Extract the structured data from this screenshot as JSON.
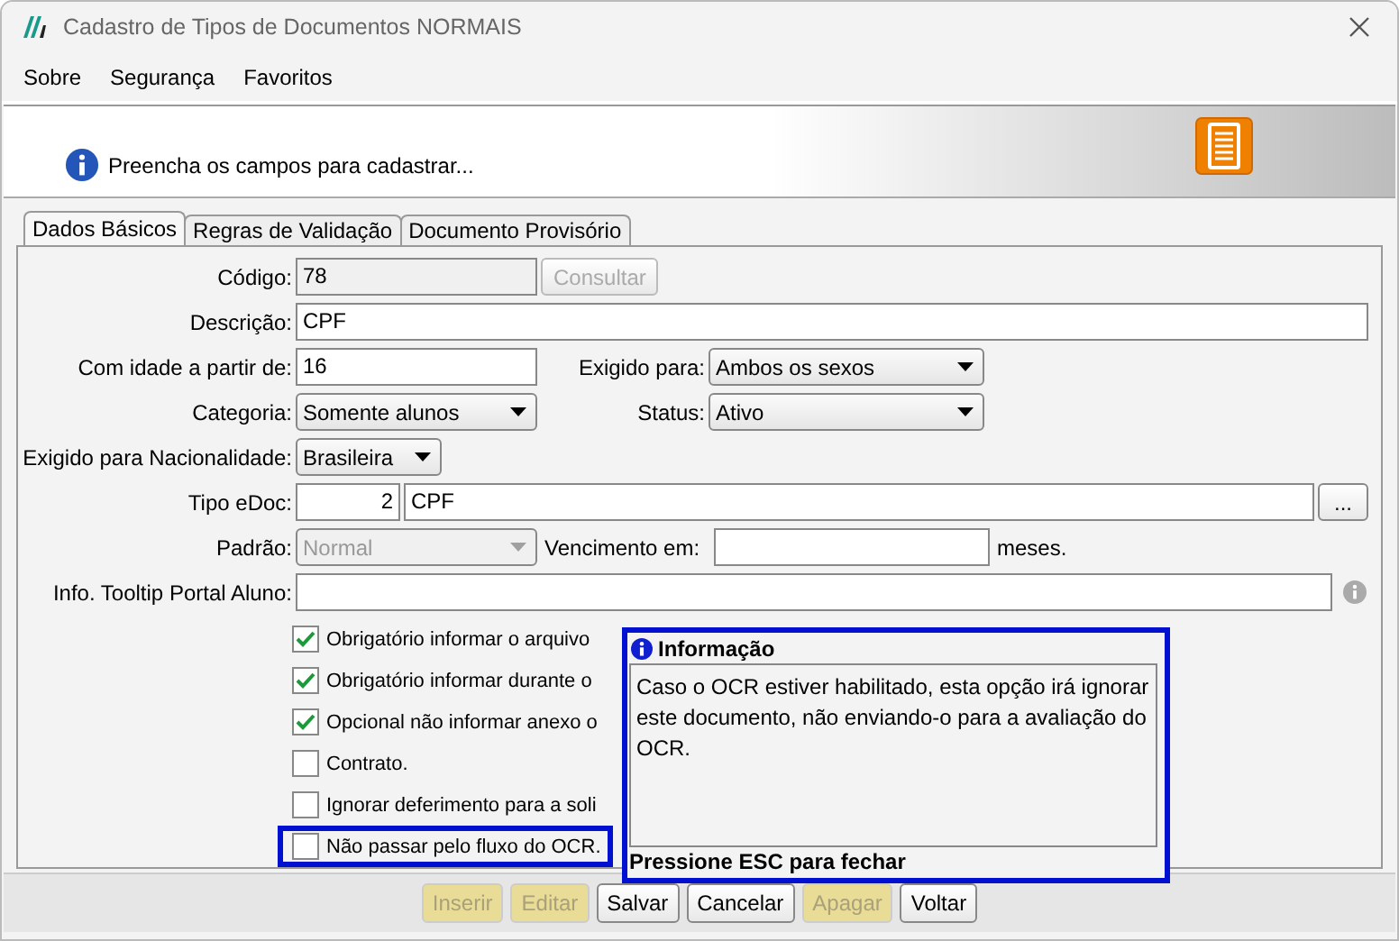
{
  "window": {
    "title": "Cadastro de Tipos de Documentos NORMAIS"
  },
  "menu": [
    "Sobre",
    "Segurança",
    "Favoritos"
  ],
  "banner": {
    "message": "Preencha os campos para cadastrar..."
  },
  "tabs": [
    {
      "label": "Dados Básicos",
      "selected": true
    },
    {
      "label": "Regras de Validação",
      "selected": false
    },
    {
      "label": "Documento Provisório",
      "selected": false
    }
  ],
  "form": {
    "codigo": {
      "label": "Código:",
      "value": "78",
      "button": "Consultar",
      "button_disabled": true
    },
    "descricao": {
      "label": "Descrição:",
      "value": "CPF"
    },
    "idade": {
      "label": "Com idade a partir de:",
      "value": "16"
    },
    "exigido_para": {
      "label": "Exigido para:",
      "value": "Ambos os sexos"
    },
    "categoria": {
      "label": "Categoria:",
      "value": "Somente alunos"
    },
    "status": {
      "label": "Status:",
      "value": "Ativo"
    },
    "nacionalidade": {
      "label": "Exigido para Nacionalidade:",
      "value": "Brasileira"
    },
    "tipo_edoc": {
      "label": "Tipo eDoc:",
      "code": "2",
      "value": "CPF",
      "button": "..."
    },
    "padrao": {
      "label": "Padrão:",
      "value": "Normal",
      "disabled": true
    },
    "vencimento": {
      "label": "Vencimento em:",
      "suffix": "meses."
    },
    "tooltip_portal": {
      "label": "Info. Tooltip Portal Aluno:"
    }
  },
  "checkboxes": [
    {
      "label": "Obrigatório informar o arquivo",
      "checked": true,
      "highlighted": false
    },
    {
      "label": "Obrigatório informar durante o",
      "checked": true,
      "highlighted": false
    },
    {
      "label": "Opcional não informar anexo o",
      "checked": true,
      "highlighted": false
    },
    {
      "label": "Contrato.",
      "checked": false,
      "highlighted": false
    },
    {
      "label": "Ignorar deferimento para a soli",
      "checked": false,
      "highlighted": false
    },
    {
      "label": "Não passar pelo fluxo do OCR.",
      "checked": false,
      "highlighted": true
    }
  ],
  "tooltip": {
    "title": "Informação",
    "body": "Caso o OCR estiver habilitado, esta opção irá ignorar este documento, não enviando-o para a avaliação do OCR.",
    "footer": "Pressione ESC para fechar"
  },
  "buttons": [
    {
      "label": "Inserir",
      "disabled": true
    },
    {
      "label": "Editar",
      "disabled": true
    },
    {
      "label": "Salvar",
      "disabled": false
    },
    {
      "label": "Cancelar",
      "disabled": false
    },
    {
      "label": "Apagar",
      "disabled": true
    },
    {
      "label": "Voltar",
      "disabled": false
    }
  ]
}
